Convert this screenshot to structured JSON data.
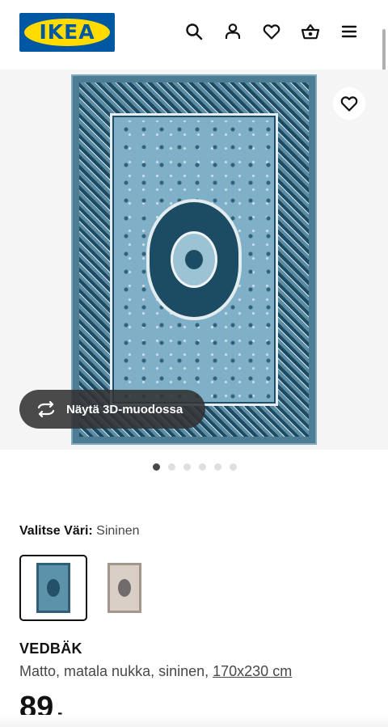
{
  "header": {
    "logo_text": "IKEA",
    "brand_colors": {
      "blue": "#0058a3",
      "yellow": "#ffdb00"
    },
    "icons": [
      "search-icon",
      "account-icon",
      "heart-icon",
      "basket-icon",
      "menu-icon"
    ]
  },
  "gallery": {
    "favorite_icon": "heart-icon",
    "view_3d_label": "Näytä 3D-muodossa",
    "view_3d_icon": "rotate-3d-icon",
    "image_count": 6,
    "active_image_index": 0
  },
  "color_selector": {
    "label": "Valitse Väri:",
    "value": "Sininen",
    "options": [
      {
        "name": "swatch-blue",
        "selected": true,
        "color": "#5d93aa"
      },
      {
        "name": "swatch-beige",
        "selected": false,
        "color": "#d9cfc6"
      }
    ]
  },
  "product": {
    "name": "VEDBÄK",
    "description": "Matto, matala nukka, sininen, ",
    "size": "170x230 cm",
    "price_integer": "89",
    "price_suffix": ",-"
  }
}
